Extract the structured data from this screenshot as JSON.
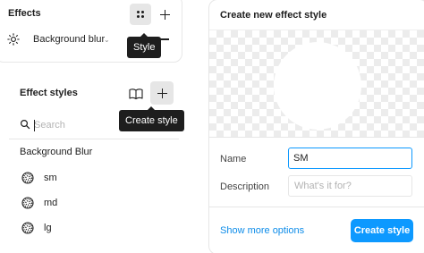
{
  "effects": {
    "title": "Effects",
    "style_tooltip": "Style",
    "row": {
      "label": "Background blur",
      "icon": "sun-icon"
    }
  },
  "effect_styles": {
    "title": "Effect styles",
    "create_tooltip": "Create style",
    "search": {
      "placeholder": "Search",
      "value": ""
    },
    "group": "Background Blur",
    "items": [
      {
        "label": "sm",
        "icon": "blur-swatch-icon"
      },
      {
        "label": "md",
        "icon": "blur-swatch-icon"
      },
      {
        "label": "lg",
        "icon": "blur-swatch-icon"
      }
    ]
  },
  "dialog": {
    "title": "Create new effect style",
    "name_label": "Name",
    "name_value": "SM",
    "description_label": "Description",
    "description_placeholder": "What's it for?",
    "more_options": "Show more options",
    "create_button": "Create style"
  },
  "colors": {
    "accent": "#0d99ff",
    "tooltip_bg": "#1e1e1e",
    "button_hover_bg": "#e6e6e6"
  }
}
